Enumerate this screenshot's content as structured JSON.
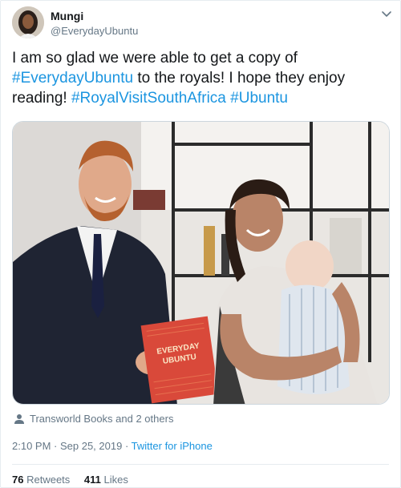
{
  "author": {
    "name": "Mungi",
    "handle": "@EverydayUbuntu"
  },
  "tweet": {
    "text_1": "I am so glad we were able to get a copy of ",
    "hashtag_1": "#EverydayUbuntu",
    "text_2": " to the royals! I hope they enjoy reading! ",
    "hashtag_2": "#RoyalVisitSouthAfrica",
    "text_3": " ",
    "hashtag_3": "#Ubuntu"
  },
  "media": {
    "book_title_line1": "EVERYDAY",
    "book_title_line2": "UBUNTU"
  },
  "tagged": {
    "icon": "person-icon",
    "text": "Transworld Books and 2 others"
  },
  "meta": {
    "time": "2:10 PM",
    "sep1": " · ",
    "date": "Sep 25, 2019",
    "sep2": " · ",
    "source": "Twitter for iPhone"
  },
  "stats": {
    "retweets_count": "76",
    "retweets_label": "Retweets",
    "likes_count": "411",
    "likes_label": "Likes"
  },
  "colors": {
    "link": "#1b95e0",
    "secondary_text": "#657786",
    "primary_text": "#14171a",
    "book_red": "#d9493a"
  }
}
